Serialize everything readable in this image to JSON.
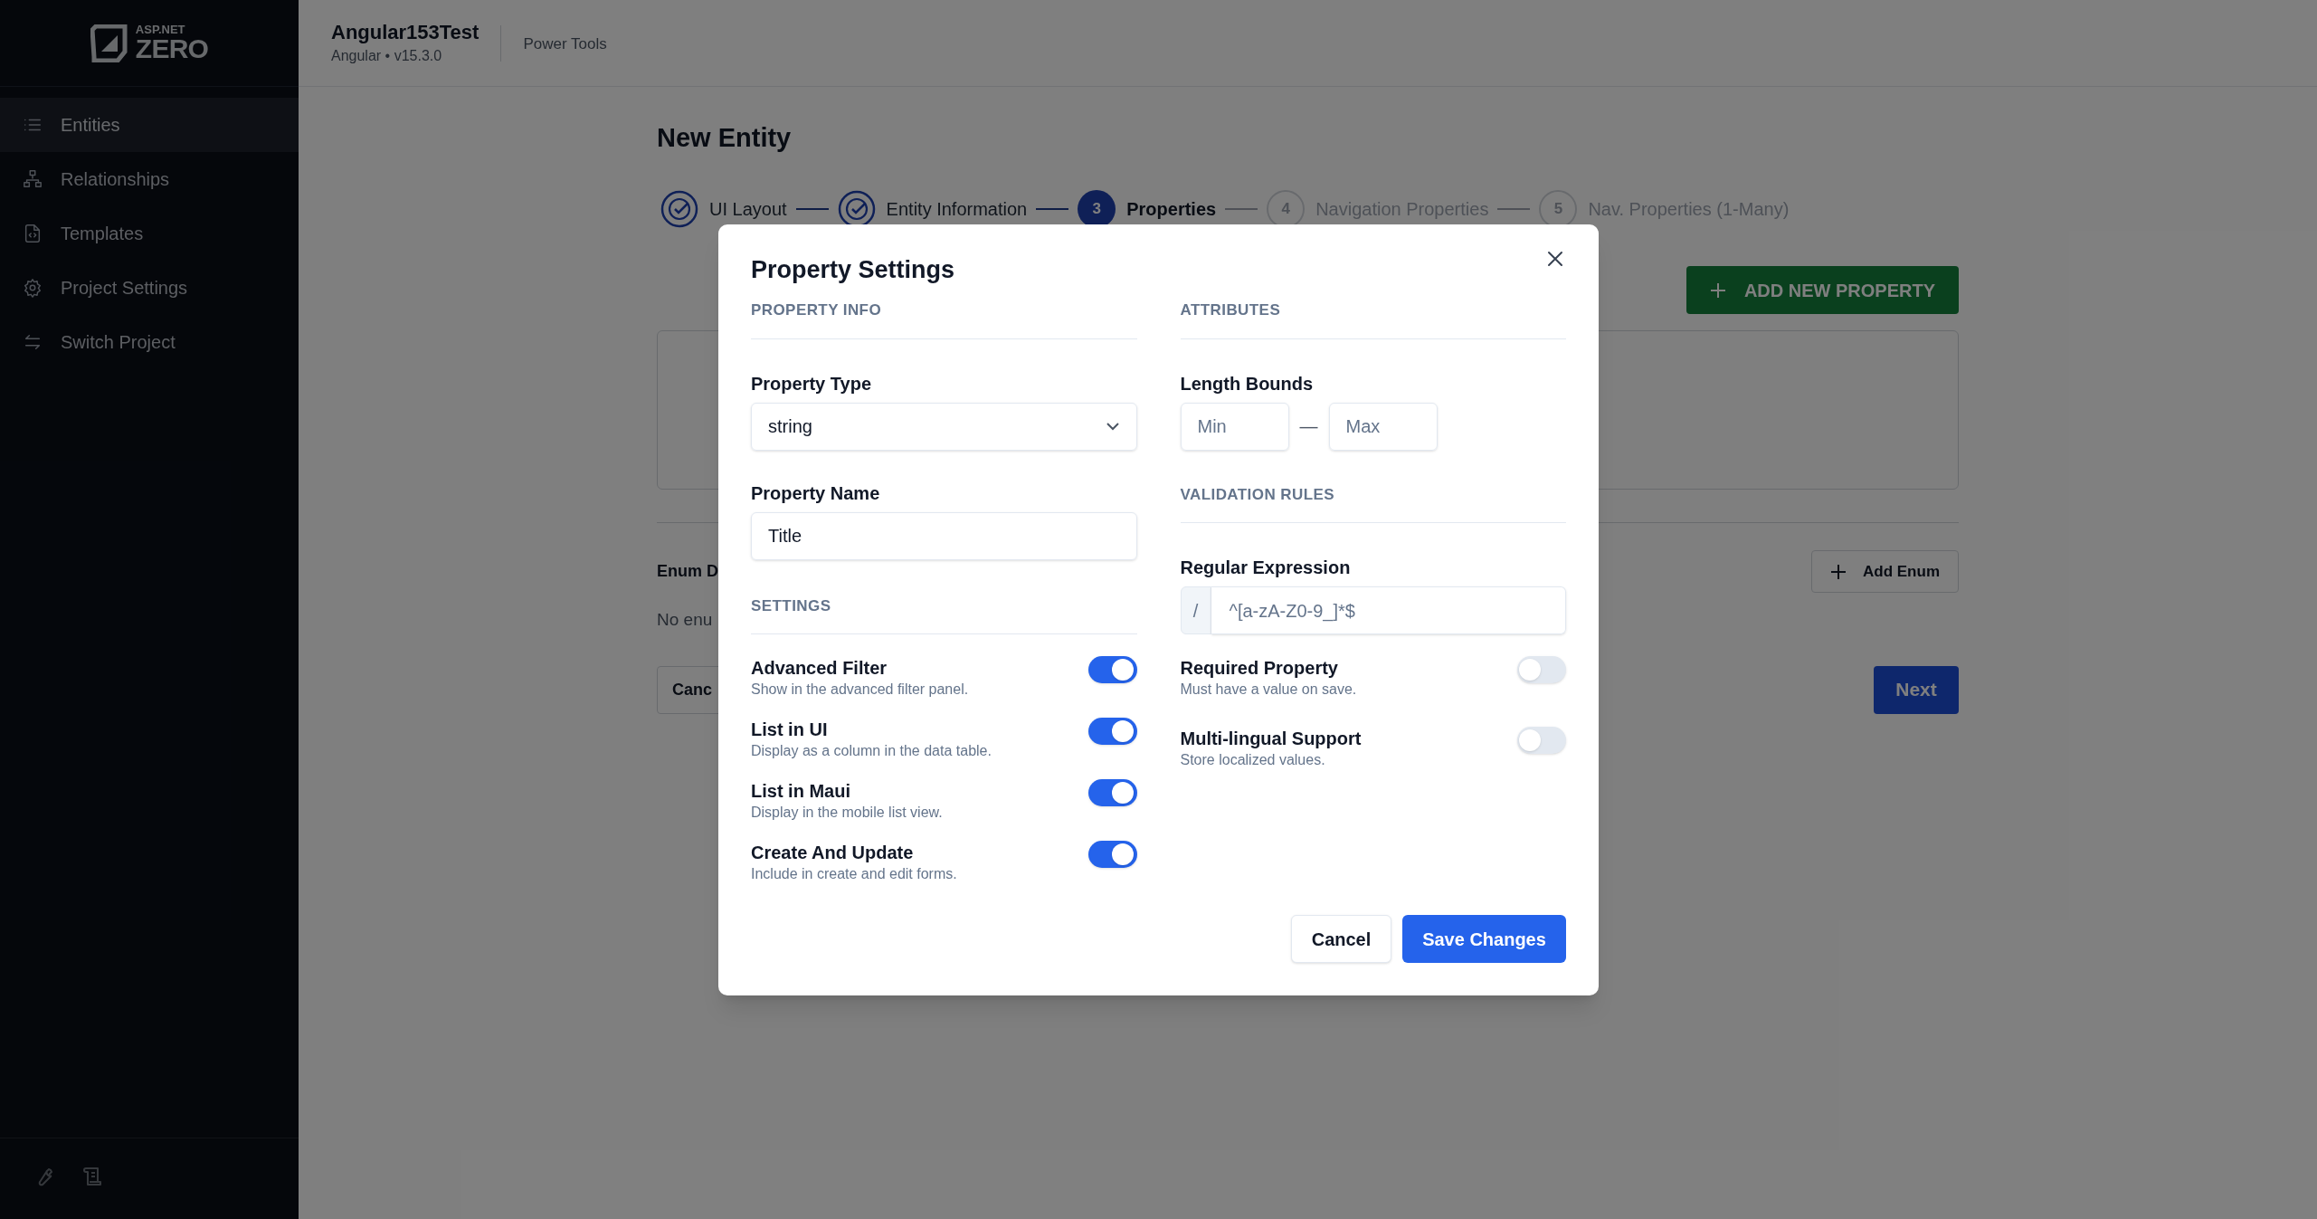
{
  "sidebar": {
    "logo": {
      "small": "ASP.NET",
      "large": "ZERO"
    },
    "items": [
      {
        "label": "Entities",
        "selected": true
      },
      {
        "label": "Relationships",
        "selected": false
      },
      {
        "label": "Templates",
        "selected": false
      },
      {
        "label": "Project Settings",
        "selected": false
      },
      {
        "label": "Switch Project",
        "selected": false
      }
    ]
  },
  "header": {
    "project": "Angular153Test",
    "subtitle": "Angular • v15.3.0",
    "link": "Power Tools"
  },
  "page": {
    "title": "New Entity",
    "steps": [
      {
        "label": "UI Layout",
        "completed": true,
        "selected": false
      },
      {
        "label": "Entity Information",
        "completed": true,
        "selected": false
      },
      {
        "number": "3",
        "label": "Properties",
        "completed": false,
        "selected": true
      },
      {
        "number": "4",
        "label": "Navigation Properties",
        "completed": false,
        "selected": false
      },
      {
        "number": "5",
        "label": "Nav. Properties (1-Many)",
        "completed": false,
        "selected": false
      }
    ],
    "add_property_button": "ADD NEW PROPERTY",
    "enum_heading": "Enum D",
    "enum_empty": "No enu",
    "add_enum_button": "Add Enum",
    "cancel_button": "Canc",
    "next_button": "Next"
  },
  "modal": {
    "title": "Property Settings",
    "left": {
      "section": "PROPERTY INFO",
      "type_label": "Property Type",
      "type_value": "string",
      "name_label": "Property Name",
      "name_value": "Title",
      "settings_section": "SETTINGS",
      "toggles": [
        {
          "label": "Advanced Filter",
          "description": "Show in the advanced filter panel.",
          "on": true
        },
        {
          "label": "List in UI",
          "description": "Display as a column in the data table.",
          "on": true
        },
        {
          "label": "List in Maui",
          "description": "Display in the mobile list view.",
          "on": true
        },
        {
          "label": "Create And Update",
          "description": "Include in create and edit forms.",
          "on": true
        }
      ]
    },
    "right": {
      "section": "ATTRIBUTES",
      "bounds_label": "Length Bounds",
      "min_placeholder": "Min",
      "separator": "—",
      "max_placeholder": "Max",
      "validation_section": "VALIDATION RULES",
      "regex_label": "Regular Expression",
      "regex_prefix": "/",
      "regex_placeholder": "^[a-zA-Z0-9_]*$",
      "toggles": [
        {
          "label": "Required Property",
          "description": "Must have a value on save.",
          "on": false
        },
        {
          "label": "Multi-lingual Support",
          "description": "Store localized values.",
          "on": false
        }
      ]
    },
    "cancel_button": "Cancel",
    "save_button": "Save Changes"
  }
}
